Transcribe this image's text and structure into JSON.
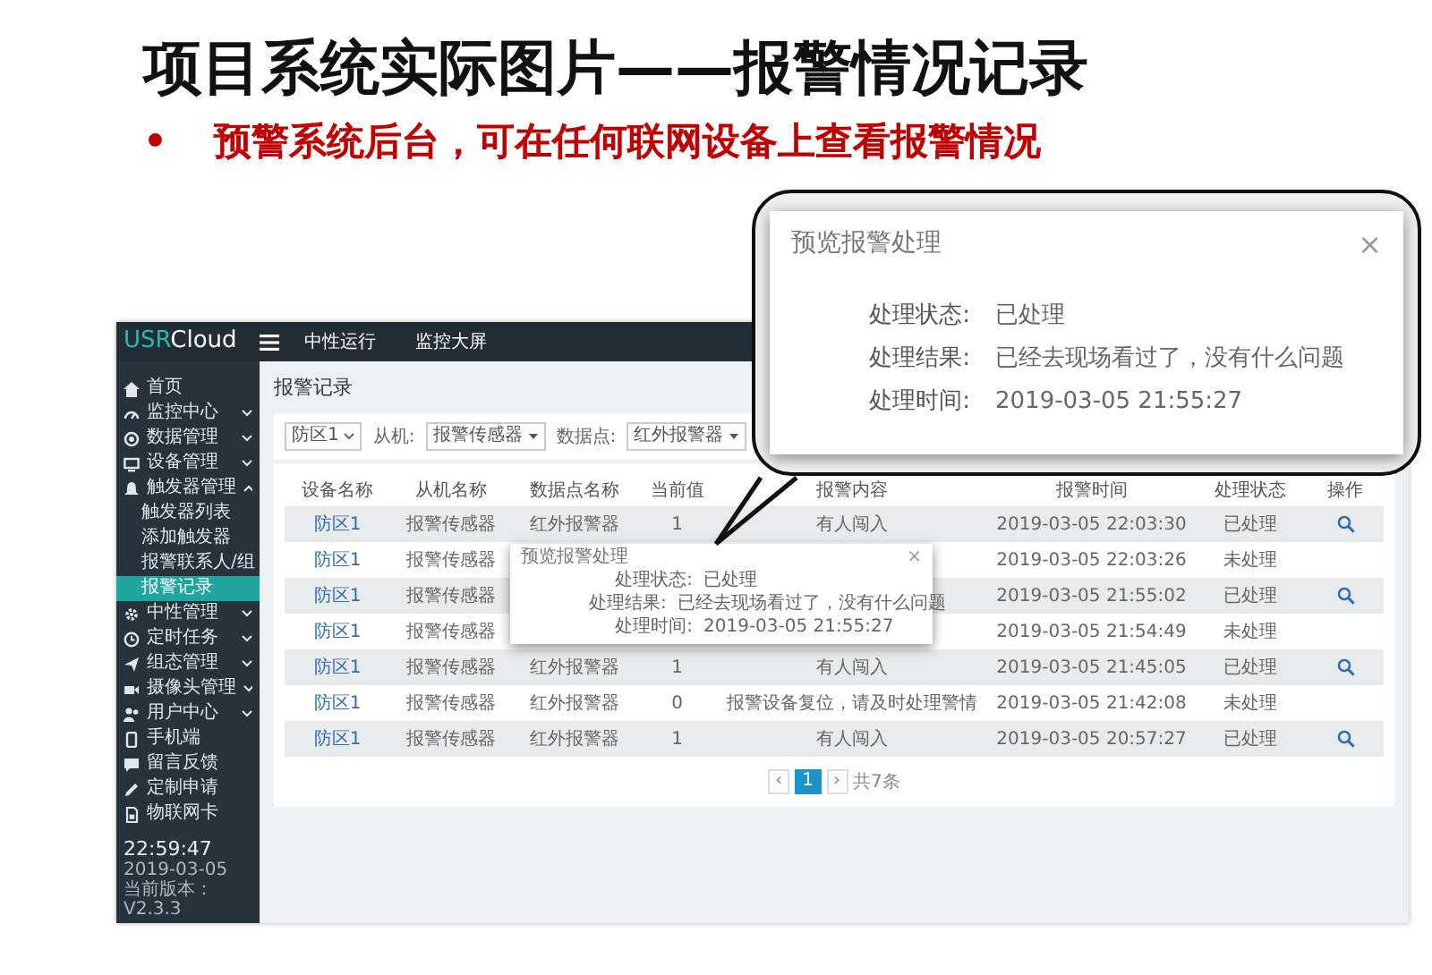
{
  "slide": {
    "title": "项目系统实际图片——报警情况记录",
    "bullet": "•",
    "subtitle": "预警系统后台，可在任何联网设备上查看报警情况"
  },
  "app": {
    "logo_prefix": "USR",
    "logo_suffix": "Cloud",
    "nav_links": [
      "中性运行",
      "监控大屏"
    ],
    "sidebar": {
      "items": [
        {
          "label": "首页",
          "selected": false
        },
        {
          "label": "监控中心",
          "selected": false,
          "expanded": false
        },
        {
          "label": "数据管理",
          "selected": false,
          "expanded": false
        },
        {
          "label": "设备管理",
          "selected": false,
          "expanded": false
        },
        {
          "label": "触发器管理",
          "selected": false,
          "expanded": true,
          "children": [
            {
              "label": "触发器列表",
              "selected": false
            },
            {
              "label": "添加触发器",
              "selected": false
            },
            {
              "label": "报警联系人/组",
              "selected": false
            },
            {
              "label": "报警记录",
              "selected": true
            }
          ]
        },
        {
          "label": "中性管理",
          "selected": false,
          "expanded": false
        },
        {
          "label": "定时任务",
          "selected": false,
          "expanded": false
        },
        {
          "label": "组态管理",
          "selected": false,
          "expanded": false
        },
        {
          "label": "摄像头管理",
          "selected": false,
          "expanded": false
        },
        {
          "label": "用户中心",
          "selected": false,
          "expanded": false
        },
        {
          "label": "手机端",
          "selected": false
        },
        {
          "label": "留言反馈",
          "selected": false
        },
        {
          "label": "定制申请",
          "selected": false
        },
        {
          "label": "物联网卡",
          "selected": false
        }
      ],
      "clock": "22:59:47",
      "date": "2019-03-05",
      "version": "当前版本：V2.3.3"
    },
    "page_title": "报警记录",
    "filters": [
      {
        "kind": "select",
        "value": "防区1"
      },
      {
        "kind": "label",
        "text": "从机:"
      },
      {
        "kind": "select",
        "value": "报警传感器"
      },
      {
        "kind": "label",
        "text": "数据点:"
      },
      {
        "kind": "select",
        "value": "红外报警器"
      }
    ],
    "table": {
      "columns": [
        "设备名称",
        "从机名称",
        "数据点名称",
        "当前值",
        "报警内容",
        "报警时间",
        "处理状态",
        "操作"
      ],
      "rows": [
        {
          "device": "防区1",
          "slave": "报警传感器",
          "data_point": "红外报警器",
          "value": "1",
          "content": "有人闯入",
          "time": "2019-03-05 22:03:30",
          "status": "已处理",
          "handled": true
        },
        {
          "device": "防区1",
          "slave": "报警传感器",
          "time": "2019-03-05 22:03:26",
          "status": "未处理",
          "handled": false
        },
        {
          "device": "防区1",
          "slave": "报警传感器",
          "time": "2019-03-05 21:55:02",
          "status": "已处理",
          "handled": true
        },
        {
          "device": "防区1",
          "slave": "报警传感器",
          "time": "2019-03-05 21:54:49",
          "status": "未处理",
          "handled": false
        },
        {
          "device": "防区1",
          "slave": "报警传感器",
          "data_point": "红外报警器",
          "value": "1",
          "content": "有人闯入",
          "time": "2019-03-05 21:45:05",
          "status": "已处理",
          "handled": true
        },
        {
          "device": "防区1",
          "slave": "报警传感器",
          "data_point": "红外报警器",
          "value": "0",
          "content": "报警设备复位，请及时处理警情",
          "time": "2019-03-05 21:42:08",
          "status": "未处理",
          "handled": false
        },
        {
          "device": "防区1",
          "slave": "报警传感器",
          "data_point": "红外报警器",
          "value": "1",
          "content": "有人闯入",
          "time": "2019-03-05 20:57:27",
          "status": "已处理",
          "handled": true
        }
      ]
    },
    "pagination": {
      "prev": "‹",
      "pages": [
        {
          "label": "1",
          "selected": true
        }
      ],
      "next": "›",
      "total": "共7条"
    },
    "modal": {
      "title": "预览报警处理",
      "close": "×",
      "fields": [
        {
          "label": "处理状态:",
          "value": "已处理"
        },
        {
          "label": "处理结果:",
          "value": "已经去现场看过了，没有什么问题"
        },
        {
          "label": "处理时间:",
          "value": "2019-03-05 21:55:27"
        }
      ]
    }
  },
  "callout": {
    "title": "预览报警处理",
    "close": "×",
    "fields": [
      {
        "label": "处理状态:",
        "value": "已处理"
      },
      {
        "label": "处理结果:",
        "value": "已经去现场看过了，没有什么问题"
      },
      {
        "label": "处理时间:",
        "value": "2019-03-05 21:55:27"
      }
    ]
  }
}
